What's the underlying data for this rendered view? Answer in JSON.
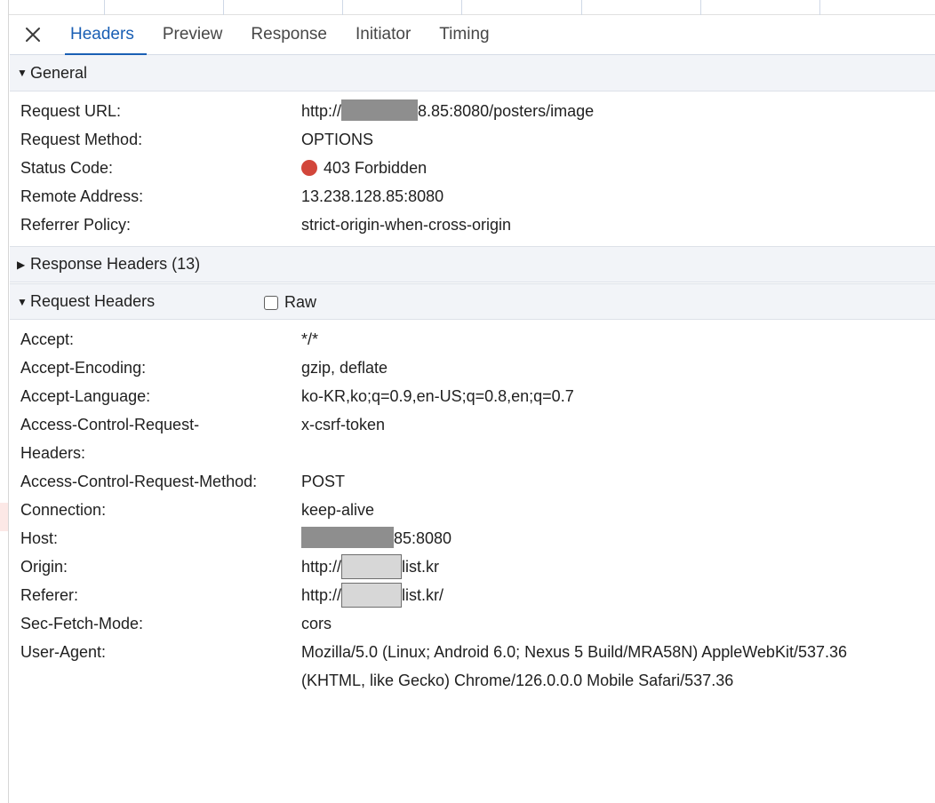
{
  "tabs": {
    "close_icon": "close-icon",
    "items": [
      "Headers",
      "Preview",
      "Response",
      "Initiator",
      "Timing"
    ],
    "active": "Headers"
  },
  "general": {
    "title": "General",
    "request_url": {
      "key": "Request URL:",
      "prefix": "http://",
      "suffix": "8.85:8080/posters/image"
    },
    "request_method": {
      "key": "Request Method:",
      "value": "OPTIONS"
    },
    "status_code": {
      "key": "Status Code:",
      "value": "403 Forbidden",
      "color": "#d2463a"
    },
    "remote_address": {
      "key": "Remote Address:",
      "value": "13.238.128.85:8080"
    },
    "referrer_policy": {
      "key": "Referrer Policy:",
      "value": "strict-origin-when-cross-origin"
    }
  },
  "response_headers": {
    "title": "Response Headers (13)"
  },
  "request_headers": {
    "title": "Request Headers",
    "raw_label": "Raw",
    "raw_checked": false,
    "accept": {
      "key": "Accept:",
      "value": "*/*"
    },
    "accept_encoding": {
      "key": "Accept-Encoding:",
      "value": "gzip, deflate"
    },
    "accept_language": {
      "key": "Accept-Language:",
      "value": "ko-KR,ko;q=0.9,en-US;q=0.8,en;q=0.7"
    },
    "acr_headers": {
      "key": "Access-Control-Request-Headers:",
      "value": "x-csrf-token"
    },
    "acr_method": {
      "key": "Access-Control-Request-Method:",
      "value": "POST"
    },
    "connection": {
      "key": "Connection:",
      "value": "keep-alive"
    },
    "host": {
      "key": "Host:",
      "suffix": "85:8080"
    },
    "origin": {
      "key": "Origin:",
      "prefix": "http://",
      "suffix": "list.kr"
    },
    "referer": {
      "key": "Referer:",
      "prefix": "http://",
      "suffix": "list.kr/"
    },
    "sec_fetch_mode": {
      "key": "Sec-Fetch-Mode:",
      "value": "cors"
    },
    "user_agent": {
      "key": "User-Agent:",
      "value": "Mozilla/5.0 (Linux; Android 6.0; Nexus 5 Build/MRA58N) AppleWebKit/537.36 (KHTML, like Gecko) Chrome/126.0.0.0 Mobile Safari/537.36"
    }
  }
}
